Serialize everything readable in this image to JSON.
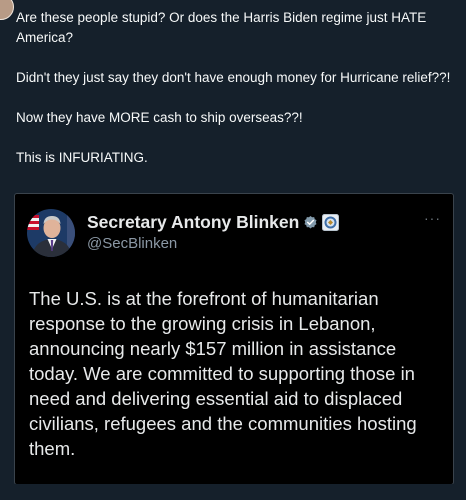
{
  "post": {
    "paragraphs": [
      "Are these people stupid? Or does the Harris Biden regime just HATE America?",
      "Didn't they just say they don't have enough money for Hurricane relief??!",
      "Now they have MORE cash to ship overseas??!",
      "This is INFURIATING."
    ]
  },
  "quote": {
    "name": "Secretary Antony Blinken",
    "handle": "@SecBlinken",
    "more_label": "···",
    "icons": {
      "verified": "verified-badge-icon",
      "affiliate": "state-department-seal-icon",
      "more": "more-options-icon"
    },
    "text": "The U.S. is at the forefront of humanitarian response to the growing crisis in Lebanon, announcing nearly $157 million in assistance today. We are committed to supporting those in need and delivering essential aid to displaced civilians, refugees and the communities hosting them."
  },
  "colors": {
    "background": "#15202b",
    "card_background": "#000000",
    "text": "#f7f9f9",
    "secondary_text": "#8b98a5",
    "verified_badge": "#829aab"
  }
}
